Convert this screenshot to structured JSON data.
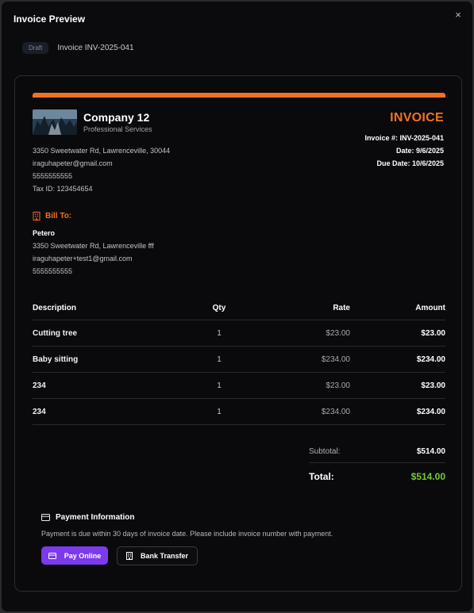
{
  "modal": {
    "title": "Invoice Preview",
    "close_symbol": "×"
  },
  "header": {
    "status_badge": "Draft",
    "invoice_ref": "Invoice INV-2025-041"
  },
  "company": {
    "name": "Company 12",
    "tagline": "Professional Services",
    "address": "3350 Sweetwater Rd, Lawrenceville, 30044",
    "email": "iraguhapeter@gmail.com",
    "phone": "5555555555",
    "tax_id": "Tax ID: 123454654"
  },
  "invoice": {
    "title": "INVOICE",
    "number": "Invoice #: INV-2025-041",
    "date": "Date: 9/6/2025",
    "due_date": "Due Date: 10/6/2025"
  },
  "bill_to": {
    "heading": "Bill To:",
    "name": "Petero",
    "address": "3350 Sweetwater Rd, Lawrenceville fff",
    "email": "iraguhapeter+test1@gmail.com",
    "phone": "5555555555"
  },
  "items": {
    "headers": {
      "description": "Description",
      "qty": "Qty",
      "rate": "Rate",
      "amount": "Amount"
    },
    "rows": [
      {
        "description": "Cutting tree",
        "qty": "1",
        "rate": "$23.00",
        "amount": "$23.00"
      },
      {
        "description": "Baby sitting",
        "qty": "1",
        "rate": "$234.00",
        "amount": "$234.00"
      },
      {
        "description": "234",
        "qty": "1",
        "rate": "$23.00",
        "amount": "$23.00"
      },
      {
        "description": "234",
        "qty": "1",
        "rate": "$234.00",
        "amount": "$234.00"
      }
    ]
  },
  "totals": {
    "subtotal_label": "Subtotal:",
    "subtotal": "$514.00",
    "total_label": "Total:",
    "total": "$514.00"
  },
  "payment": {
    "heading": "Payment Information",
    "note": "Payment is due within 30 days of invoice date. Please include invoice number with payment.",
    "pay_online_label": "Pay Online",
    "bank_transfer_label": "Bank Transfer"
  },
  "colors": {
    "accent": "#f0711f",
    "total": "#78c833",
    "primary_button": "#7c3aed"
  }
}
